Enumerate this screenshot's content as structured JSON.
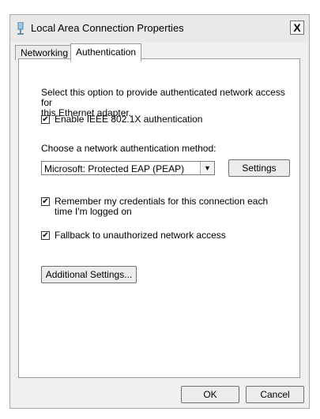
{
  "window": {
    "title": "Local Area Connection Properties",
    "close_label": "X"
  },
  "tabs": [
    {
      "label": "Networking",
      "active": false
    },
    {
      "label": "Authentication",
      "active": true
    }
  ],
  "auth": {
    "description_line1": "Select this option to provide authenticated network access for",
    "description_line2": "this Ethernet adapter.",
    "enable_8021x": {
      "label": "Enable IEEE 802.1X authentication",
      "checked": true
    },
    "method_label": "Choose a network authentication method:",
    "method_select": {
      "value": "Microsoft: Protected EAP (PEAP)"
    },
    "settings_button": "Settings",
    "remember_credentials": {
      "label_line1": "Remember my credentials for this connection each",
      "label_line2": "time I'm logged on",
      "checked": true
    },
    "fallback": {
      "label": "Fallback to unauthorized network access",
      "checked": true
    },
    "additional_settings_button": "Additional Settings..."
  },
  "footer": {
    "ok_label": "OK",
    "cancel_label": "Cancel"
  },
  "icons": {
    "title": "network-adapter-icon",
    "check": "✔",
    "dropdown": "▼"
  }
}
